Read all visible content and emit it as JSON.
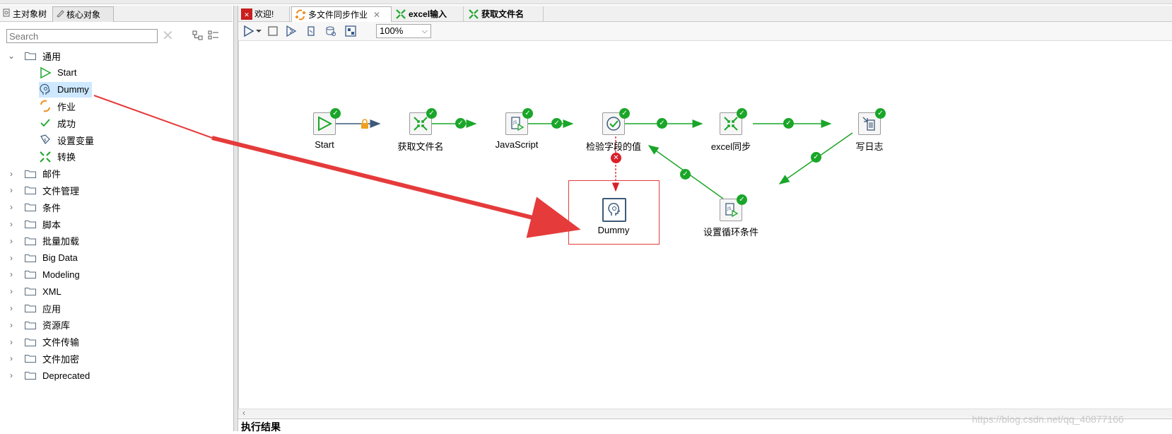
{
  "left_panel": {
    "tabs": [
      "主对象树",
      "核心对象"
    ],
    "search": {
      "placeholder": "Search",
      "value": ""
    },
    "tree": [
      {
        "label": "通用",
        "expanded": true,
        "children": [
          {
            "label": "Start",
            "icon": "start-icon"
          },
          {
            "label": "Dummy",
            "icon": "dummy-icon",
            "selected": true
          },
          {
            "label": "作业",
            "icon": "job-icon"
          },
          {
            "label": "成功",
            "icon": "success-icon"
          },
          {
            "label": "设置变量",
            "icon": "set-variable-icon"
          },
          {
            "label": "转换",
            "icon": "transform-icon"
          }
        ]
      },
      {
        "label": "邮件"
      },
      {
        "label": "文件管理"
      },
      {
        "label": "条件"
      },
      {
        "label": "脚本"
      },
      {
        "label": "批量加载"
      },
      {
        "label": "Big Data"
      },
      {
        "label": "Modeling"
      },
      {
        "label": "XML"
      },
      {
        "label": "应用"
      },
      {
        "label": "资源库"
      },
      {
        "label": "文件传输"
      },
      {
        "label": "文件加密"
      },
      {
        "label": "Deprecated"
      }
    ]
  },
  "editor": {
    "tabs": [
      {
        "label": "欢迎!",
        "icon": "welcome-icon"
      },
      {
        "label": "多文件同步作业",
        "icon": "job-icon",
        "active": true,
        "closable": true
      },
      {
        "label": "excel输入",
        "icon": "transform-icon"
      },
      {
        "label": "获取文件名",
        "icon": "transform-icon"
      }
    ],
    "zoom": "100%",
    "canvas": {
      "nodes": {
        "start": "Start",
        "get_filenames": "获取文件名",
        "javascript": "JavaScript",
        "check_field": "检验字段的值",
        "excel_sync": "excel同步",
        "write_log": "写日志",
        "dummy": "Dummy",
        "set_loop": "设置循环条件"
      }
    },
    "results_label": "执行结果"
  },
  "watermark": "https://blog.csdn.net/qq_40877166",
  "colors": {
    "hop_green": "#1aa629",
    "hop_error": "#d9202b",
    "arrow_red": "#e53b3b",
    "lock_orange": "#f0a020",
    "selection": "#cde8ff"
  }
}
